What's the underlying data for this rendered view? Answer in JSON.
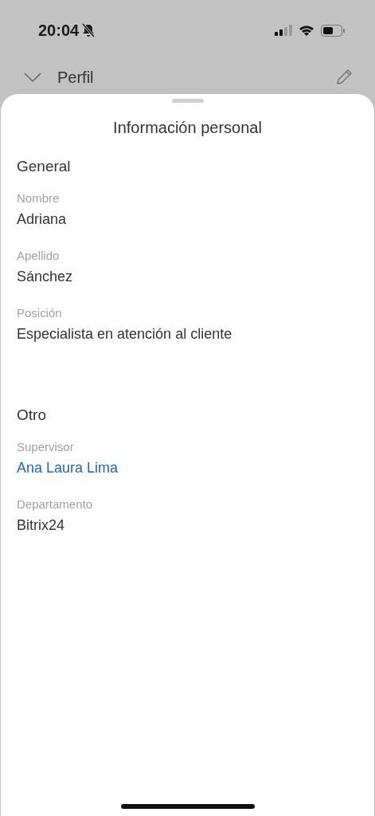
{
  "status_bar": {
    "time": "20:04",
    "silent": true
  },
  "header": {
    "title": "Perfil"
  },
  "sheet": {
    "title": "Información personal",
    "sections": [
      {
        "title": "General",
        "fields": [
          {
            "label": "Nombre",
            "value": "Adriana",
            "kind": "text"
          },
          {
            "label": "Apellido",
            "value": "Sánchez",
            "kind": "text"
          },
          {
            "label": "Posición",
            "value": "Especialista en atención al cliente",
            "kind": "text"
          }
        ]
      },
      {
        "title": "Otro",
        "fields": [
          {
            "label": "Supervisor",
            "value": "Ana Laura Lima",
            "kind": "link"
          },
          {
            "label": "Departamento",
            "value": "Bitrix24",
            "kind": "text"
          }
        ]
      }
    ]
  }
}
